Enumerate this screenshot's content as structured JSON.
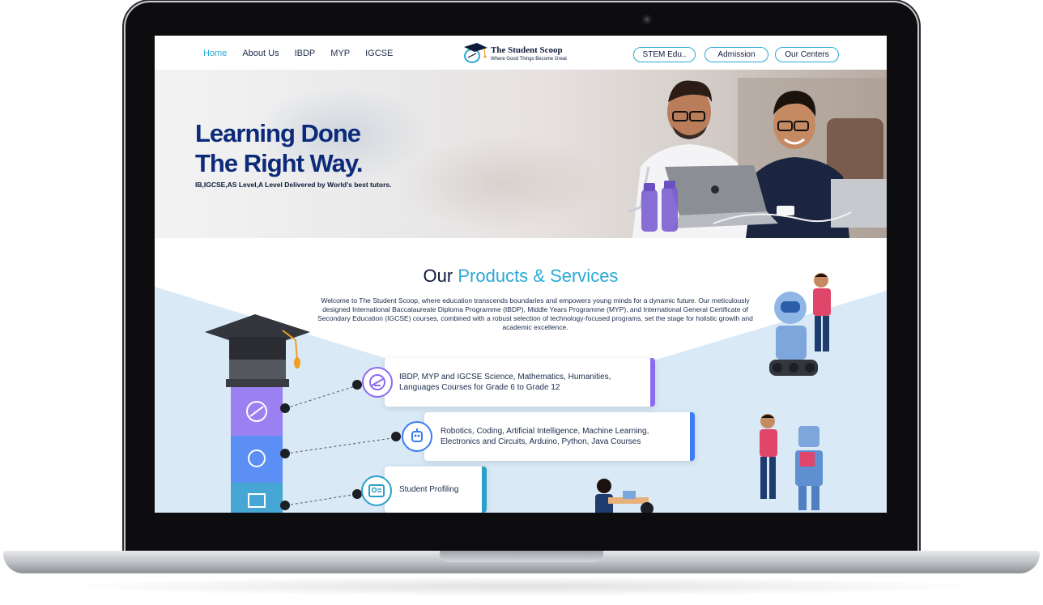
{
  "nav": {
    "links": [
      "Home",
      "About Us",
      "IBDP",
      "MYP",
      "IGCSE"
    ],
    "active_link": "Home",
    "buttons": [
      "STEM Edu..",
      "Admission",
      "Our Centers"
    ]
  },
  "logo": {
    "title": "The Student Scoop",
    "tagline": "Where Good Things Become Great"
  },
  "hero": {
    "title_line1": "Learning Done",
    "title_line2": "The Right Way.",
    "subtitle": "IB,IGCSE,AS Level,A Level Delivered by World’s best tutors."
  },
  "products": {
    "title_part1": "Our",
    "title_part2": "Products & Services",
    "description": "Welcome to The Student Scoop, where education transcends boundaries and empowers young  minds for a dynamic future. Our meticulously designed International Baccalaureate Diploma  Programme (IBDP), Middle Years Programme (MYP), and International General Certificate of  Secondary Education (IGCSE) courses, combined with a robust selection of technology-focused  programs, set the stage for holistic growth and academic excellence.",
    "cards": [
      {
        "text": "IBDP, MYP and IGCSE Science, Mathematics, Humanities, Languages Courses  for Grade 6 to Grade 12",
        "icon": "protractor-icon",
        "color": "#8b6cf0"
      },
      {
        "text": "Robotics, Coding, Artificial Intelligence, Machine Learning, Electronics and Circuits, Arduino, Python, Java Courses",
        "icon": "robot-head-icon",
        "color": "#3a7df0"
      },
      {
        "text": "Student Profiling",
        "icon": "profile-card-icon",
        "color": "#2aa0c8"
      }
    ]
  },
  "colors": {
    "accent": "#28a9d6",
    "navy": "#0c2a7a",
    "purple": "#8b6cf0",
    "blue": "#3a7df0",
    "teal": "#2aa0c8"
  }
}
